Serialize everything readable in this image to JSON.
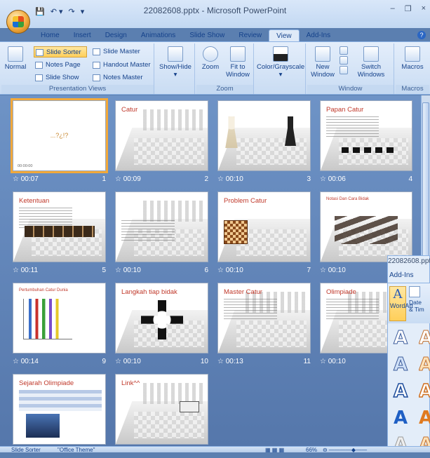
{
  "app": {
    "window_title": "22082608.pptx - Microsoft PowerPoint",
    "win_min": "–",
    "win_close": "×"
  },
  "tabs": [
    "Home",
    "Insert",
    "Design",
    "Animations",
    "Slide Show",
    "Review",
    "View",
    "Add-Ins"
  ],
  "ribbon": {
    "normal": "Normal",
    "slide_sorter": "Slide Sorter",
    "notes_page": "Notes Page",
    "slide_show": "Slide Show",
    "slide_master": "Slide Master",
    "handout_master": "Handout Master",
    "notes_master": "Notes Master",
    "group_presentation_views": "Presentation Views",
    "show_hide": "Show/Hide",
    "zoom": "Zoom",
    "fit_to": "Fit to",
    "window_word": "Window",
    "group_zoom": "Zoom",
    "color_grayscale": "Color/Grayscale",
    "new_window_1": "New",
    "new_window_2": "Window",
    "switch_1": "Switch",
    "switch_2": "Windows",
    "group_window": "Window",
    "macros": "Macros",
    "group_macros": "Macros"
  },
  "slides": [
    {
      "title": "",
      "center_text": "...?¿!?",
      "time": "00:07",
      "number": "1",
      "selected": true,
      "footer": "00:00:00"
    },
    {
      "title": "Catur",
      "time": "00:09",
      "number": "2"
    },
    {
      "title": "",
      "time": "00:10",
      "number": "3"
    },
    {
      "title": "Papan Catur",
      "time": "00:06",
      "number": "4"
    },
    {
      "title": "Ketentuan",
      "time": "00:11",
      "number": "5"
    },
    {
      "title": "",
      "time": "00:10",
      "number": "6"
    },
    {
      "title": "Problem Catur",
      "time": "00:10",
      "number": "7"
    },
    {
      "title": "Notasi Dan Cara Bidak",
      "time": "00:10",
      "number": ""
    },
    {
      "title": "Pertumbuhan Catur Dunia",
      "time": "00:14",
      "number": "9"
    },
    {
      "title": "Langkah tiap bidak",
      "time": "00:10",
      "number": "10"
    },
    {
      "title": "Master Catur",
      "time": "00:13",
      "number": "11"
    },
    {
      "title": "Olimpiade",
      "time": "00:10",
      "number": ""
    },
    {
      "title": "Sejarah Olimpiade",
      "time": "",
      "number": ""
    },
    {
      "title": "Link^^",
      "time": "",
      "number": ""
    }
  ],
  "popup": {
    "title": "22082608.pptx",
    "tab": "Add-Ins",
    "wordart": "WordArt",
    "date_1": "Date",
    "date_2": "& Tim"
  },
  "status": {
    "view": "Slide Sorter",
    "theme": "\"Office Theme\"",
    "zoom": "66%"
  },
  "colors": {
    "slide_title": "#c0392b",
    "selection": "#f2a93b",
    "sorter_bg": "#5b7fb0"
  }
}
